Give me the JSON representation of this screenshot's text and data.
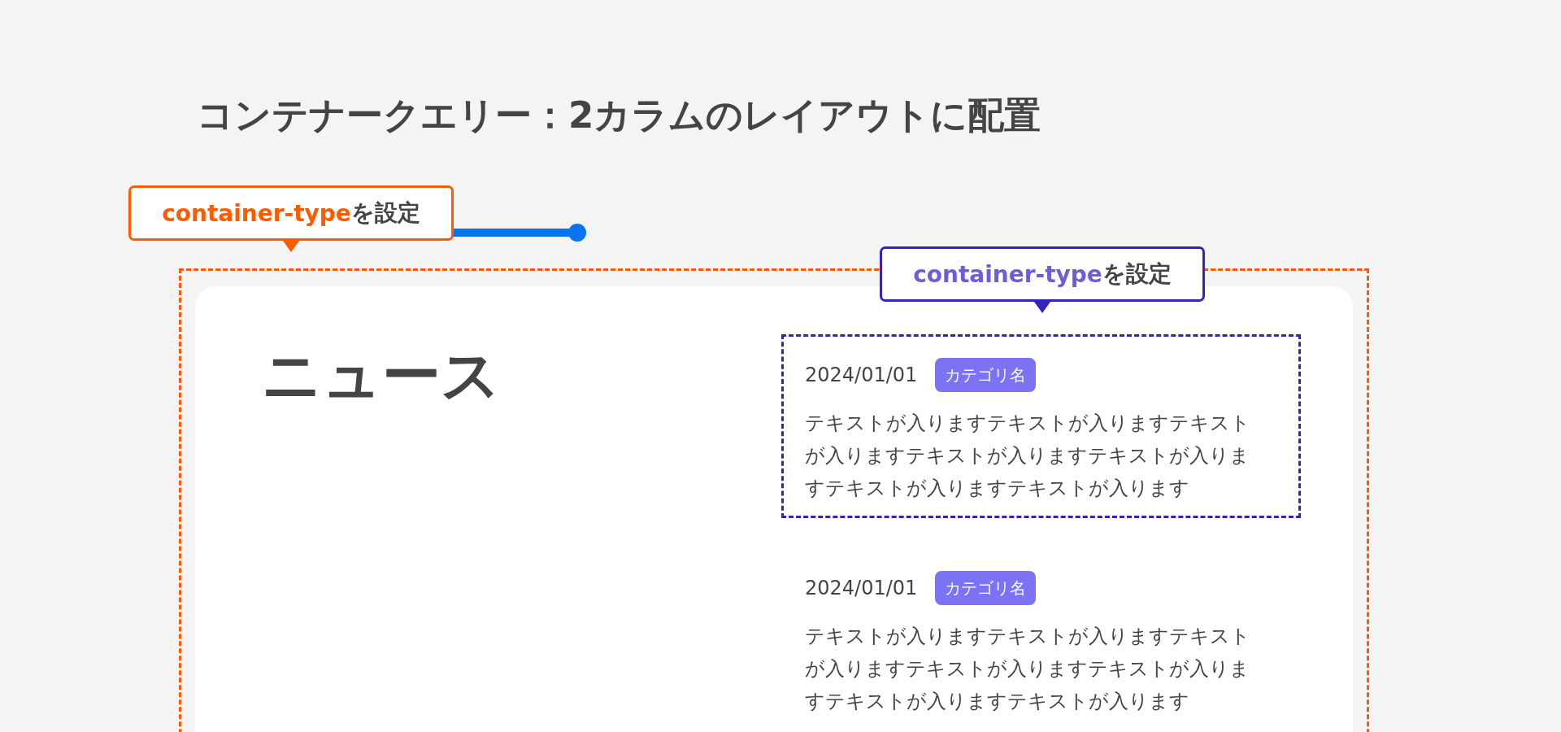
{
  "title": "コンテナークエリー：2カラムのレイアウトに配置",
  "callouts": [
    {
      "color": "#ff5a00",
      "code": "container-type",
      "text": "を設定"
    },
    {
      "color": "#3322bb",
      "code": "container-type",
      "text": "を設定"
    }
  ],
  "section": {
    "heading": "ニュース",
    "items": [
      {
        "date": "2024/01/01",
        "category": "カテゴリ名",
        "text": "テキストが入りますテキストが入りますテキストが入りますテキストが入りますテキストが入りますテキストが入りますテキストが入ります",
        "outlined": true
      },
      {
        "date": "2024/01/01",
        "category": "カテゴリ名",
        "text": "テキストが入りますテキストが入りますテキストが入りますテキストが入りますテキストが入りますテキストが入りますテキストが入ります",
        "outlined": false
      }
    ]
  }
}
